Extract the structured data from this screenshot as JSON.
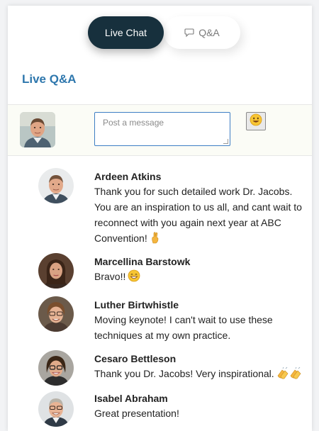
{
  "tabs": {
    "live_chat": "Live Chat",
    "qa": "Q&A"
  },
  "section_title": "Live Q&A",
  "composer": {
    "placeholder": "Post a message",
    "emoji_button_icon": "smiley-face-icon"
  },
  "messages": [
    {
      "author": "Ardeen Atkins",
      "text": "Thank you for such detailed work Dr. Jacobs. You are an inspiration to us all, and cant wait to reconnect with you again next year at ABC Convention!",
      "emoji": "crossed-fingers-icon"
    },
    {
      "author": "Marcellina Barstowk",
      "text": "Bravo!!",
      "emoji": "grinning-face-icon"
    },
    {
      "author": "Luther Birtwhistle",
      "text": "Moving keynote! I can't wait to use these techniques at my own practice.",
      "emoji": ""
    },
    {
      "author": "Cesaro Bettleson",
      "text": "Thank you Dr. Jacobs! Very inspirational.",
      "emoji": "clapping-hands-icon"
    },
    {
      "author": "Isabel Abraham",
      "text": "Great presentation!",
      "emoji": ""
    }
  ],
  "colors": {
    "active_tab": "#17303d",
    "title_blue": "#2e77ad",
    "input_border": "#3e7ec4",
    "composer_bg": "#fbfcf6"
  }
}
